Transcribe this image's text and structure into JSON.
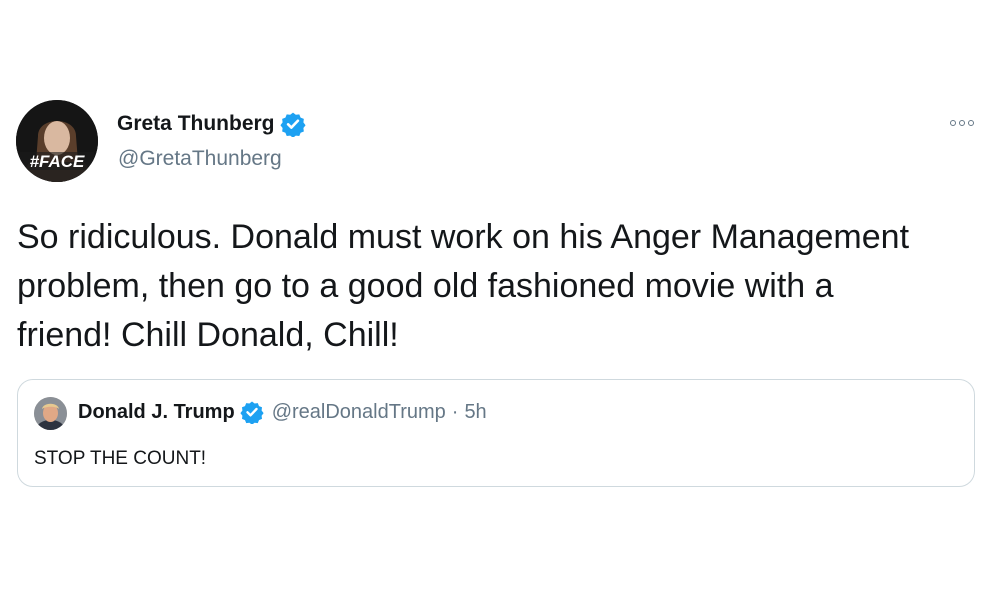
{
  "tweet": {
    "author_name": "Greta Thunberg",
    "author_handle": "@GretaThunberg",
    "avatar_overlay_text": "#FACE",
    "text": "So ridiculous. Donald must work on his Anger Management problem, then go to a good old fashioned movie with a friend! Chill Donald, Chill!",
    "verified_color": "#1da1f2"
  },
  "quoted_tweet": {
    "author_name": "Donald J. Trump",
    "author_handle": "@realDonaldTrump",
    "separator": "·",
    "timestamp": "5h",
    "text": "STOP THE COUNT!"
  },
  "icons": {
    "verified": "verified-badge-icon",
    "more": "more-options-icon"
  },
  "colors": {
    "primary_text": "#14171a",
    "secondary_text": "#657786",
    "border": "#cfd9de"
  }
}
